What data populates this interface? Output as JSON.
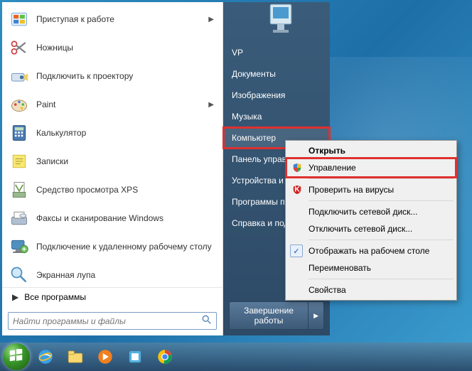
{
  "sidebar_programs": [
    {
      "label": "Приступая к работе",
      "icon": "getting-started",
      "submenu": true
    },
    {
      "label": "Ножницы",
      "icon": "snip",
      "submenu": false
    },
    {
      "label": "Подключить к проектору",
      "icon": "projector",
      "submenu": false
    },
    {
      "label": "Paint",
      "icon": "paint",
      "submenu": true
    },
    {
      "label": "Калькулятор",
      "icon": "calc",
      "submenu": false
    },
    {
      "label": "Записки",
      "icon": "notes",
      "submenu": false
    },
    {
      "label": "Средство просмотра XPS",
      "icon": "xps",
      "submenu": false
    },
    {
      "label": "Факсы и сканирование Windows",
      "icon": "fax",
      "submenu": false
    },
    {
      "label": "Подключение к удаленному рабочему столу",
      "icon": "rdp",
      "submenu": false
    },
    {
      "label": "Экранная лупа",
      "icon": "magnifier",
      "submenu": false
    }
  ],
  "all_programs_label": "Все программы",
  "search_placeholder": "Найти программы и файлы",
  "right_items": [
    {
      "label": "VP",
      "highlight": false
    },
    {
      "label": "Документы",
      "highlight": false
    },
    {
      "label": "Изображения",
      "highlight": false
    },
    {
      "label": "Музыка",
      "highlight": false
    },
    {
      "label": "Компьютер",
      "highlight": true
    },
    {
      "label": "Панель управления",
      "highlight": false
    },
    {
      "label": "Устройства и принтеры",
      "highlight": false
    },
    {
      "label": "Программы по умолчанию",
      "highlight": false
    },
    {
      "label": "Справка и поддержка",
      "highlight": false
    }
  ],
  "shutdown_label": "Завершение работы",
  "context_menu": [
    {
      "label": "Открыть",
      "bold": true,
      "icon": "",
      "sep": false,
      "check": false,
      "highlight": false
    },
    {
      "label": "Управление",
      "bold": false,
      "icon": "shield",
      "sep": false,
      "check": false,
      "highlight": true
    },
    {
      "sep": true
    },
    {
      "label": "Проверить на вирусы",
      "bold": false,
      "icon": "av",
      "sep": false,
      "check": false,
      "highlight": false
    },
    {
      "sep": true
    },
    {
      "label": "Подключить сетевой диск...",
      "bold": false,
      "icon": "",
      "sep": false,
      "check": false,
      "highlight": false
    },
    {
      "label": "Отключить сетевой диск...",
      "bold": false,
      "icon": "",
      "sep": false,
      "check": false,
      "highlight": false
    },
    {
      "sep": true
    },
    {
      "label": "Отображать на рабочем столе",
      "bold": false,
      "icon": "",
      "sep": false,
      "check": true,
      "highlight": false
    },
    {
      "label": "Переименовать",
      "bold": false,
      "icon": "",
      "sep": false,
      "check": false,
      "highlight": false
    },
    {
      "sep": true
    },
    {
      "label": "Свойства",
      "bold": false,
      "icon": "",
      "sep": false,
      "check": false,
      "highlight": false
    }
  ]
}
